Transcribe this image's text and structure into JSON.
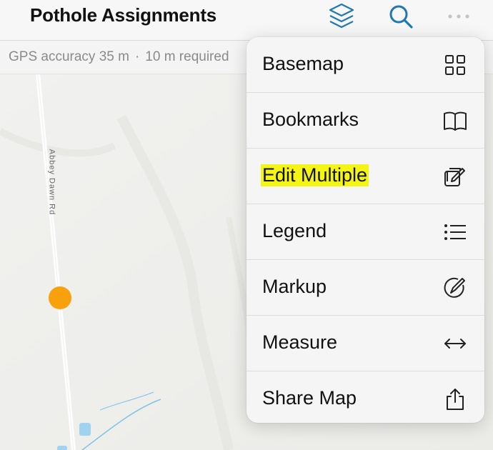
{
  "header": {
    "title": "Pothole Assignments",
    "icons": [
      "layers-icon",
      "search-icon",
      "more-icon"
    ],
    "accent_color": "#1f78b4"
  },
  "gps": {
    "accuracy": "GPS accuracy 35 m",
    "separator": "·",
    "required": "10 m required"
  },
  "map": {
    "road_label": "Abbey Dawn Rd",
    "marker_color": "#f9a10d",
    "water_color": "#7fc3e8"
  },
  "menu": {
    "items": [
      {
        "label": "Basemap",
        "icon": "grid-icon"
      },
      {
        "label": "Bookmarks",
        "icon": "book-icon"
      },
      {
        "label": "Edit Multiple",
        "icon": "edit-icon",
        "highlight_color": "#f5f515"
      },
      {
        "label": "Legend",
        "icon": "list-icon"
      },
      {
        "label": "Markup",
        "icon": "markup-icon"
      },
      {
        "label": "Measure",
        "icon": "measure-icon"
      },
      {
        "label": "Share Map",
        "icon": "share-icon"
      }
    ]
  }
}
